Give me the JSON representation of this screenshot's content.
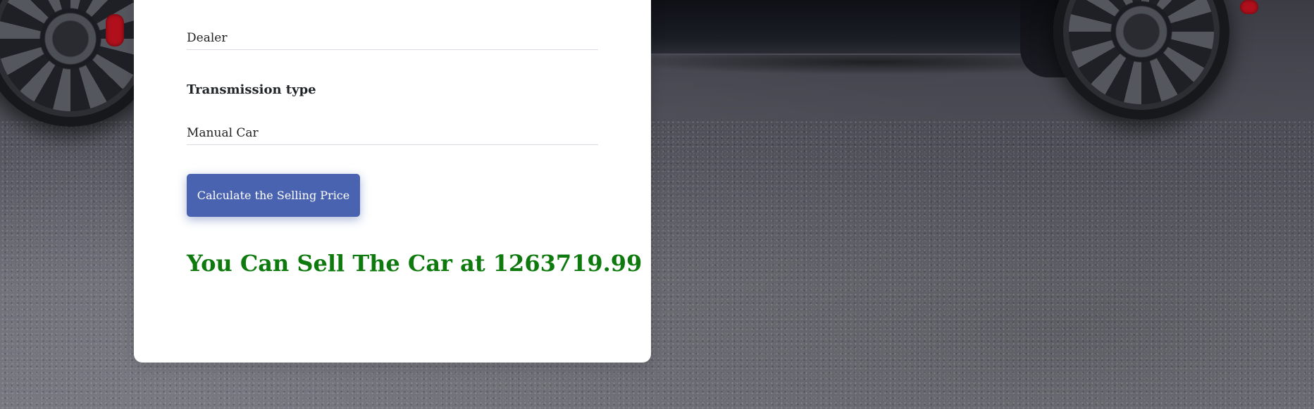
{
  "form": {
    "seller_type_value": "Dealer",
    "transmission_label": "Transmission type",
    "transmission_value": "Manual Car",
    "submit_label": "Calculate the Selling Price"
  },
  "result": {
    "text": "You Can Sell The Car at 1263719.99"
  },
  "colors": {
    "button": "#4a63b0",
    "result": "#0e7a0e"
  }
}
